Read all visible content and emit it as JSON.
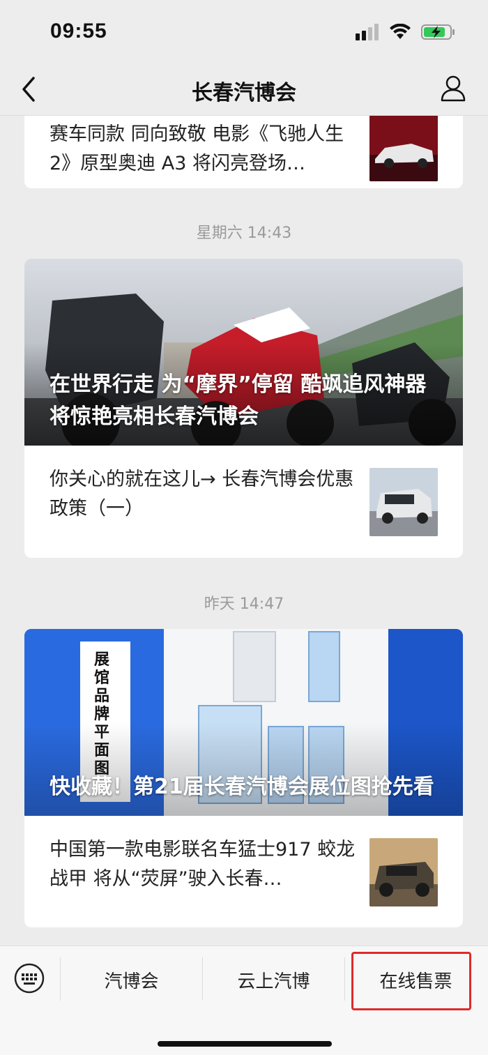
{
  "status_bar": {
    "time": "09:55"
  },
  "nav": {
    "title": "长春汽博会"
  },
  "messages": {
    "partial_item": {
      "title": "赛车同款 同向致敬 电影《飞驰人生2》原型奥迪 A3 将闪亮登场…"
    },
    "group1": {
      "timestamp": "星期六 14:43",
      "hero_title": "在世界行走 为“摩界”停留 酷飒追风神器将惊艳亮相长春汽博会",
      "sub_title": "你关心的就在这儿→ 长春汽博会优惠政策（一）"
    },
    "group2": {
      "timestamp": "昨天 14:47",
      "hero_title": "快收藏！第21届长春汽博会展位图抢先看",
      "sub_title": "中国第一款电影联名车猛士917 蛟龙战甲 将从“荧屏”驶入长春…",
      "hero_poster_text": "展馆品牌平面图"
    }
  },
  "bottom_menu": {
    "item1": "汽博会",
    "item2": "云上汽博",
    "item3": "在线售票"
  },
  "colors": {
    "highlight": "#e02a2a",
    "map_blue": "#1f5fd6"
  }
}
